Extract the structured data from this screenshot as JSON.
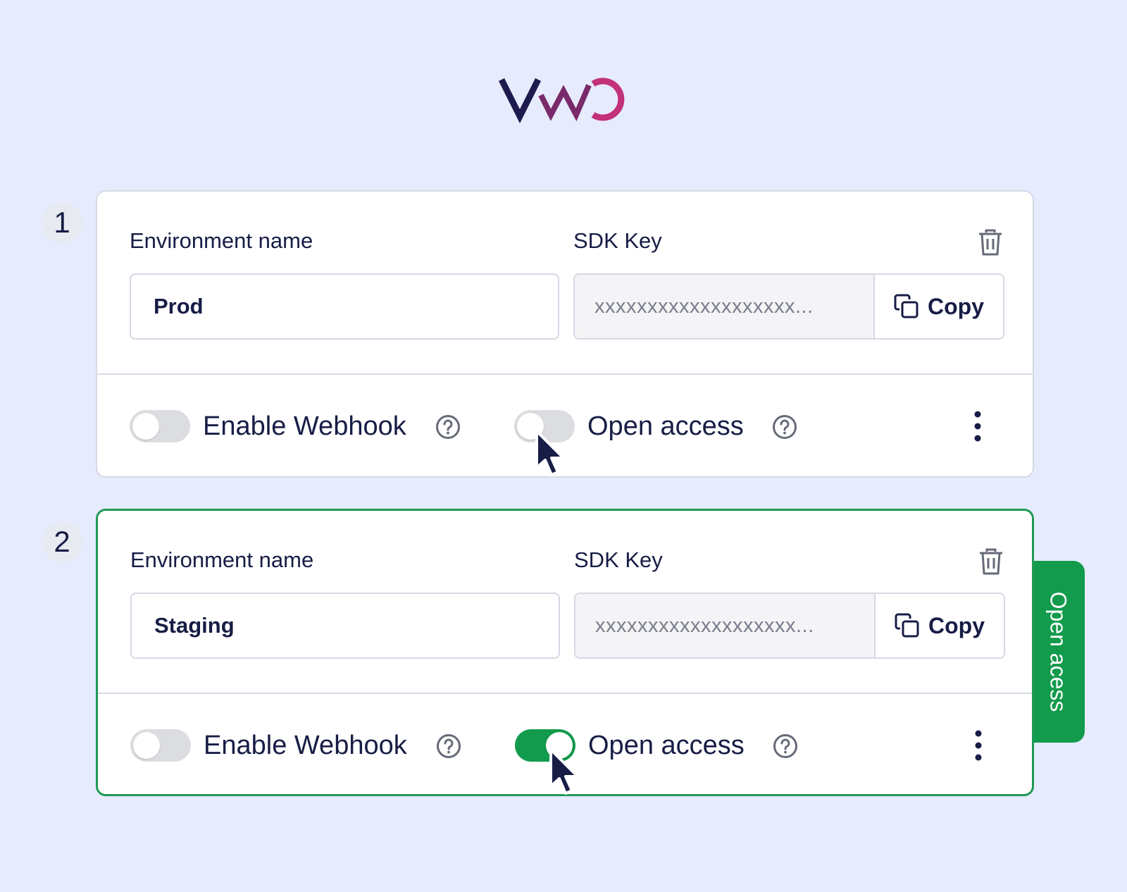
{
  "brand": {
    "logo_text": "VWO",
    "colors": {
      "dark": "#1f1a4e",
      "magenta": "#c2317a"
    }
  },
  "colors": {
    "active_green": "#129b4c",
    "background": "#e6ebfd",
    "text": "#171d45"
  },
  "environments": [
    {
      "step": "1",
      "env_label": "Environment name",
      "sdk_label": "SDK Key",
      "env_value": "Prod",
      "sdk_value": "xxxxxxxxxxxxxxxxxxx...",
      "copy_label": "Copy",
      "webhook_label": "Enable Webhook",
      "webhook_on": false,
      "open_access_label": "Open access",
      "open_access_on": false
    },
    {
      "step": "2",
      "env_label": "Environment name",
      "sdk_label": "SDK Key",
      "env_value": "Staging",
      "sdk_value": "xxxxxxxxxxxxxxxxxxx...",
      "copy_label": "Copy",
      "webhook_label": "Enable Webhook",
      "webhook_on": false,
      "open_access_label": "Open access",
      "open_access_on": true
    }
  ],
  "side_tab": {
    "label": "Open acess"
  },
  "icons": [
    "trash-icon",
    "copy-icon",
    "help-icon",
    "more-vertical-icon",
    "mouse-cursor-icon"
  ]
}
